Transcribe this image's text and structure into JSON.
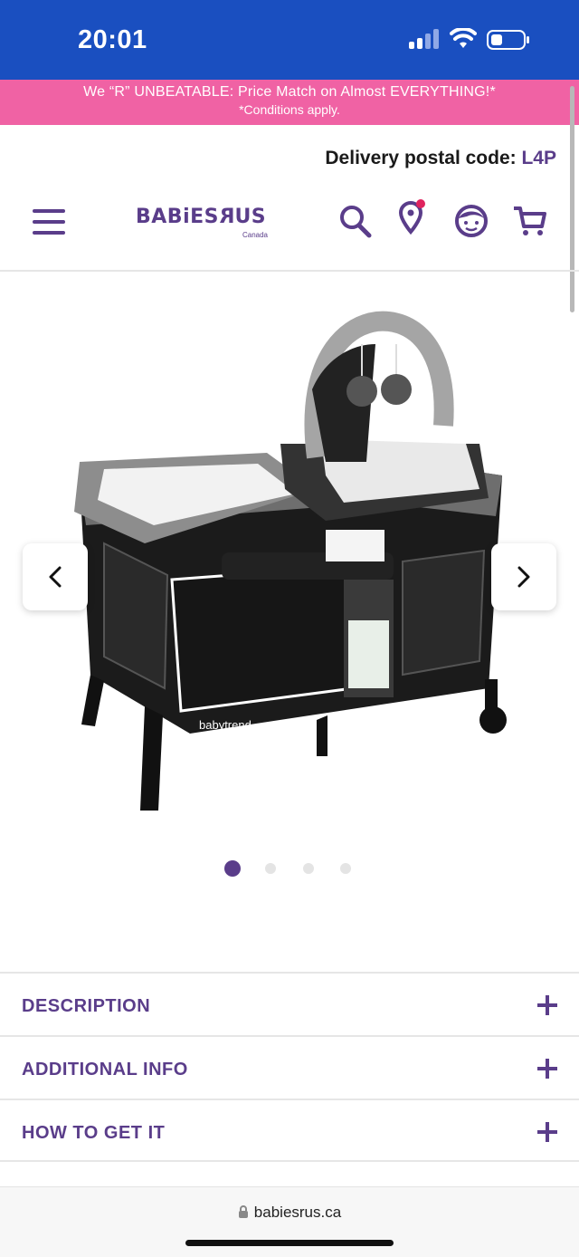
{
  "status_bar": {
    "time": "20:01"
  },
  "promo": {
    "line1": "We “R” UNBEATABLE: Price Match on Almost EVERYTHING!*",
    "line2": "*Conditions apply."
  },
  "delivery": {
    "label": "Delivery postal code:",
    "code": "L4P"
  },
  "header": {
    "logo_text": "BABiES",
    "logo_r": "R",
    "logo_us": "US",
    "logo_sub": "Canada",
    "icons": [
      "search-icon",
      "store-locator-icon",
      "account-icon",
      "cart-icon"
    ]
  },
  "product": {
    "brand_mark": "babytrend",
    "image_count": 4,
    "active_image": 1
  },
  "accordion": [
    {
      "label": "DESCRIPTION"
    },
    {
      "label": "ADDITIONAL INFO"
    },
    {
      "label": "HOW TO GET IT"
    }
  ],
  "browser": {
    "url": "babiesrus.ca"
  },
  "colors": {
    "brand_purple": "#5a3d8a",
    "promo_pink": "#f062a4",
    "status_blue": "#1a4fc0"
  }
}
